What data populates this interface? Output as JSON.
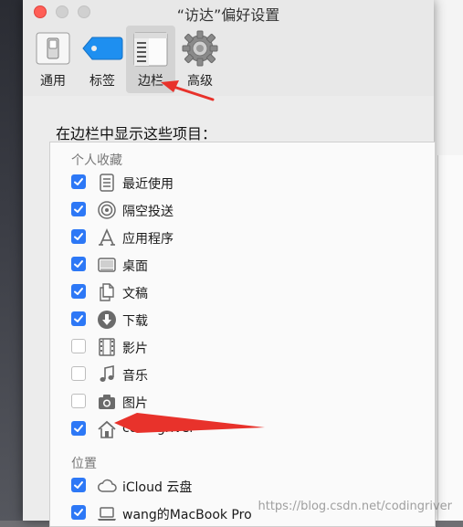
{
  "window": {
    "title": "“访达”偏好设置"
  },
  "tabs": [
    {
      "label": "通用",
      "icon": "switch-icon",
      "active": false
    },
    {
      "label": "标签",
      "icon": "tag-icon",
      "active": false
    },
    {
      "label": "边栏",
      "icon": "sidebar-icon",
      "active": true
    },
    {
      "label": "高级",
      "icon": "gear-icon",
      "active": false
    }
  ],
  "content": {
    "heading": "在边栏中显示这些项目：",
    "sections": [
      {
        "label": "个人收藏",
        "items": [
          {
            "label": "最近使用",
            "icon": "recents-icon",
            "checked": true
          },
          {
            "label": "隔空投送",
            "icon": "airdrop-icon",
            "checked": true
          },
          {
            "label": "应用程序",
            "icon": "applications-icon",
            "checked": true
          },
          {
            "label": "桌面",
            "icon": "desktop-icon",
            "checked": true
          },
          {
            "label": "文稿",
            "icon": "documents-icon",
            "checked": true
          },
          {
            "label": "下载",
            "icon": "downloads-icon",
            "checked": true
          },
          {
            "label": "影片",
            "icon": "movies-icon",
            "checked": false
          },
          {
            "label": "音乐",
            "icon": "music-icon",
            "checked": false
          },
          {
            "label": "图片",
            "icon": "pictures-icon",
            "checked": false
          },
          {
            "label": "codingriver",
            "icon": "home-icon",
            "checked": true
          }
        ]
      },
      {
        "label": "位置",
        "items": [
          {
            "label": "iCloud 云盘",
            "icon": "icloud-icon",
            "checked": true
          },
          {
            "label": "wang的MacBook Pro",
            "icon": "laptop-icon",
            "checked": true
          }
        ]
      }
    ]
  },
  "watermark": "https://blog.csdn.net/codingriver",
  "colors": {
    "accent": "#2d78f6",
    "annotation_arrow": "#e8322b"
  }
}
